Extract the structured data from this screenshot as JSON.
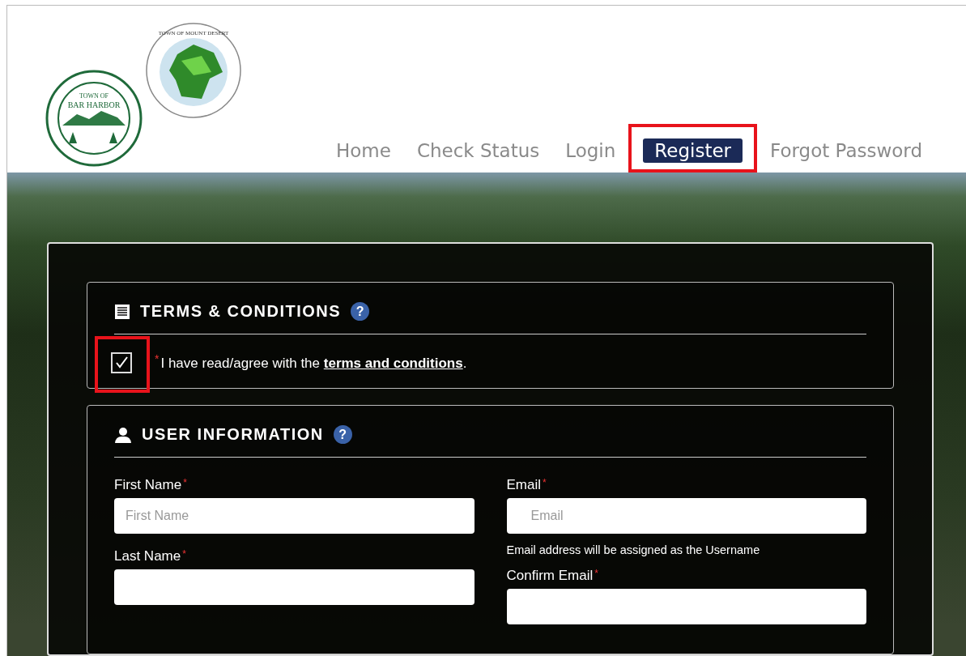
{
  "logos": [
    {
      "kind": "harbor",
      "top_text": "TOWN OF",
      "main_text": "BAR HARBOR"
    },
    {
      "kind": "island",
      "top_text": "TOWN OF MOUNT DESERT"
    }
  ],
  "nav": [
    {
      "label": "Home",
      "selected": false,
      "highlighted": false
    },
    {
      "label": "Check Status",
      "selected": false,
      "highlighted": false
    },
    {
      "label": "Login",
      "selected": false,
      "highlighted": false
    },
    {
      "label": "Register",
      "selected": true,
      "highlighted": true
    },
    {
      "label": "Forgot Password",
      "selected": false,
      "highlighted": false
    }
  ],
  "terms": {
    "title": "TERMS & CONDITIONS",
    "help": "?",
    "checked": true,
    "highlighted": true,
    "required_mark": "*",
    "text_before": "I have read/agree with the",
    "link": "terms and conditions",
    "text_after": "."
  },
  "user_info": {
    "title": "USER INFORMATION",
    "help": "?",
    "fields": [
      {
        "label": "First Name",
        "required_mark": "*",
        "placeholder": "First Name"
      },
      {
        "label": "Email",
        "required_mark": "*",
        "placeholder": "Email",
        "hint": "Email address will be assigned as the Username"
      },
      {
        "label": "Last Name",
        "required_mark": "*"
      },
      {
        "label": "Confirm Email",
        "required_mark": "*"
      }
    ]
  }
}
